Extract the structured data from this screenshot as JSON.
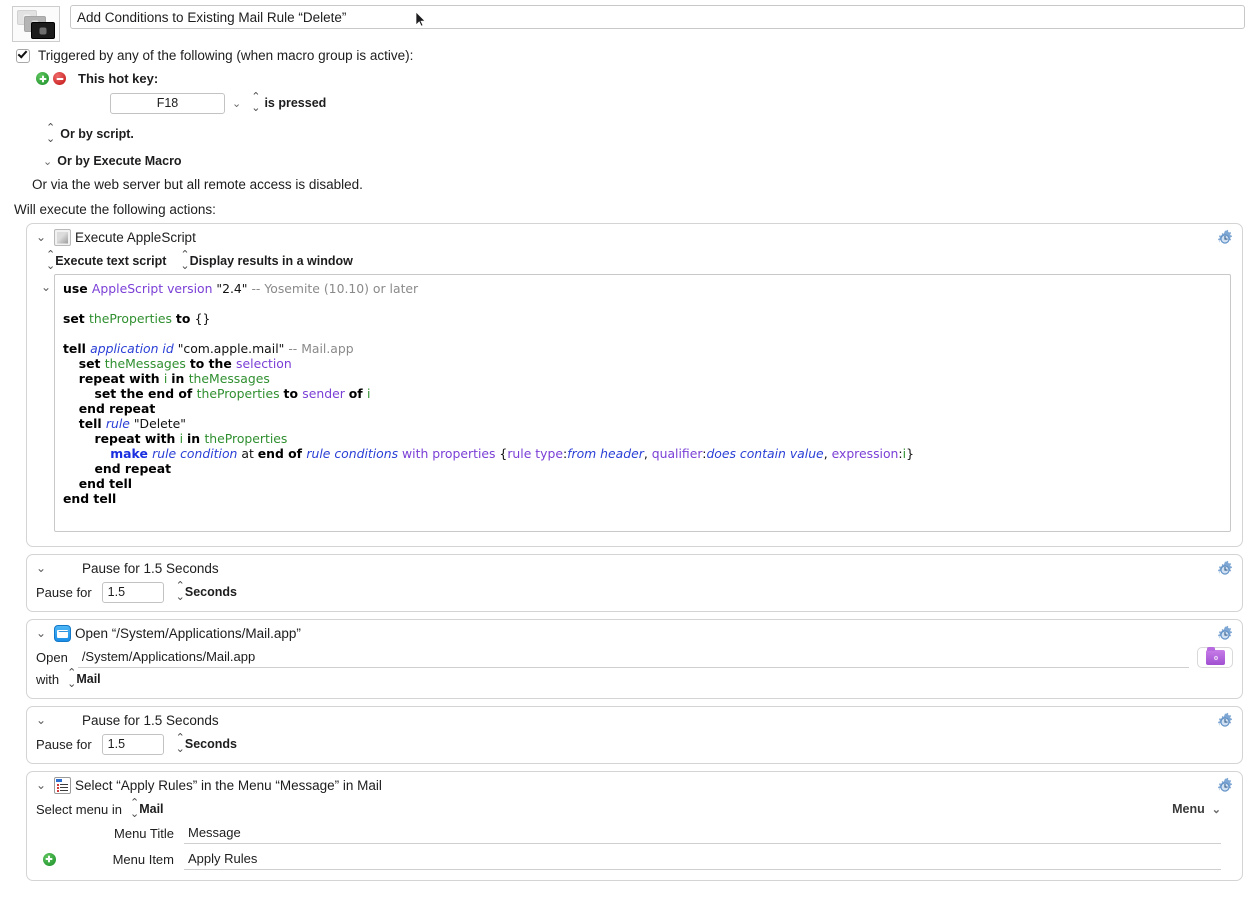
{
  "header": {
    "macro_icon": "macro-keycaps-icon",
    "title_value": "Add Conditions to Existing Mail Rule “Delete”"
  },
  "triggers": {
    "checkbox_checked": true,
    "checkbox_label": "Triggered by any of the following (when macro group is active):",
    "add_icon": "add-trigger-icon",
    "remove_icon": "remove-trigger-icon",
    "hotkey_label": "This hot key:",
    "hotkey_value": "F18",
    "hotkey_condition": "is pressed",
    "or_by_script": "Or by script.",
    "or_by_execute_macro": "Or by Execute Macro",
    "web_server_note": "Or via the web server but all remote access is disabled."
  },
  "actions_intro": "Will execute the following actions:",
  "actions": [
    {
      "title": "Execute AppleScript",
      "icon": "applescript-document-icon",
      "gear": "gear-clock-icon",
      "script_type": "Execute text script",
      "results_option": "Display results in a window",
      "script_lines": [
        [
          {
            "t": "use ",
            "c": "k"
          },
          {
            "t": "AppleScript version ",
            "c": "cls"
          },
          {
            "t": "\"2.4\" ",
            "c": "str"
          },
          {
            "t": "-- Yosemite (10.10) or later",
            "c": "cmt"
          }
        ],
        [],
        [
          {
            "t": "set ",
            "c": "k"
          },
          {
            "t": "theProperties ",
            "c": "var"
          },
          {
            "t": "to ",
            "c": "k"
          },
          {
            "t": "{}",
            "c": "str"
          }
        ],
        [],
        [
          {
            "t": "tell ",
            "c": "k"
          },
          {
            "t": "application id ",
            "c": "blue-i"
          },
          {
            "t": "\"com.apple.mail\" ",
            "c": "str"
          },
          {
            "t": "-- Mail.app",
            "c": "cmt"
          }
        ],
        [
          {
            "t": "    ",
            "c": "str"
          },
          {
            "t": "set ",
            "c": "k"
          },
          {
            "t": "theMessages ",
            "c": "var"
          },
          {
            "t": "to the ",
            "c": "k"
          },
          {
            "t": "selection",
            "c": "cls"
          }
        ],
        [
          {
            "t": "    ",
            "c": "str"
          },
          {
            "t": "repeat with ",
            "c": "k"
          },
          {
            "t": "i ",
            "c": "var"
          },
          {
            "t": "in ",
            "c": "k"
          },
          {
            "t": "theMessages",
            "c": "var"
          }
        ],
        [
          {
            "t": "        ",
            "c": "str"
          },
          {
            "t": "set the end of ",
            "c": "k"
          },
          {
            "t": "theProperties ",
            "c": "var"
          },
          {
            "t": "to ",
            "c": "k"
          },
          {
            "t": "sender ",
            "c": "cls"
          },
          {
            "t": "of ",
            "c": "k"
          },
          {
            "t": "i",
            "c": "var"
          }
        ],
        [
          {
            "t": "    ",
            "c": "str"
          },
          {
            "t": "end repeat",
            "c": "k"
          }
        ],
        [
          {
            "t": "    ",
            "c": "str"
          },
          {
            "t": "tell ",
            "c": "k"
          },
          {
            "t": "rule ",
            "c": "blue-i"
          },
          {
            "t": "\"Delete\"",
            "c": "str"
          }
        ],
        [
          {
            "t": "        ",
            "c": "str"
          },
          {
            "t": "repeat with ",
            "c": "k"
          },
          {
            "t": "i ",
            "c": "var"
          },
          {
            "t": "in ",
            "c": "k"
          },
          {
            "t": "theProperties",
            "c": "var"
          }
        ],
        [
          {
            "t": "            ",
            "c": "str"
          },
          {
            "t": "make ",
            "c": "blue"
          },
          {
            "t": "rule condition ",
            "c": "blue-i"
          },
          {
            "t": "at ",
            "c": "str"
          },
          {
            "t": "end of ",
            "c": "k"
          },
          {
            "t": "rule conditions ",
            "c": "blue-i"
          },
          {
            "t": "with properties ",
            "c": "cls"
          },
          {
            "t": "{",
            "c": "str"
          },
          {
            "t": "rule type",
            "c": "cls"
          },
          {
            "t": ":",
            "c": "str"
          },
          {
            "t": "from header",
            "c": "blue-i"
          },
          {
            "t": ", ",
            "c": "str"
          },
          {
            "t": "qualifier",
            "c": "cls"
          },
          {
            "t": ":",
            "c": "str"
          },
          {
            "t": "does contain value",
            "c": "blue-i"
          },
          {
            "t": ", ",
            "c": "str"
          },
          {
            "t": "expression",
            "c": "cls"
          },
          {
            "t": ":",
            "c": "str"
          },
          {
            "t": "i",
            "c": "var"
          },
          {
            "t": "}",
            "c": "str"
          }
        ],
        [
          {
            "t": "        ",
            "c": "str"
          },
          {
            "t": "end repeat",
            "c": "k"
          }
        ],
        [
          {
            "t": "    ",
            "c": "str"
          },
          {
            "t": "end tell",
            "c": "k"
          }
        ],
        [
          {
            "t": "end tell",
            "c": "k"
          }
        ]
      ]
    },
    {
      "title": "Pause for 1.5 Seconds",
      "gear": "gear-clock-icon",
      "pause_label": "Pause for",
      "pause_value": "1.5",
      "pause_units": "Seconds"
    },
    {
      "title": "Open “/System/Applications/Mail.app”",
      "icon": "mail-app-icon",
      "gear": "gear-clock-icon",
      "open_label": "Open",
      "open_value": "/System/Applications/Mail.app",
      "browse_icon": "folder-settings-icon",
      "with_label": "with",
      "with_value": "Mail"
    },
    {
      "title": "Pause for 1.5 Seconds",
      "gear": "gear-clock-icon",
      "pause_label": "Pause for",
      "pause_value": "1.5",
      "pause_units": "Seconds"
    },
    {
      "title": "Select “Apply Rules” in the Menu “Message” in Mail",
      "icon": "menu-list-icon",
      "gear": "gear-clock-icon",
      "select_menu_label": "Select menu in",
      "select_menu_app": "Mail",
      "menu_mode": "Menu",
      "menu_title_label": "Menu Title",
      "menu_title_value": "Message",
      "menu_item_label": "Menu Item",
      "menu_item_value": "Apply Rules",
      "add_icon": "add-menu-item-icon"
    }
  ],
  "colors": {
    "accent_blue": "#1a8fe8",
    "add_green": "#1a8f28",
    "remove_red": "#c01212",
    "folder_purple": "#a04fd0",
    "keyword_black": "#000000",
    "class_purple": "#7a3fd6",
    "variable_green": "#2f8f2f",
    "comment_gray": "#8a8a8a",
    "term_blue": "#2a3fd6"
  }
}
